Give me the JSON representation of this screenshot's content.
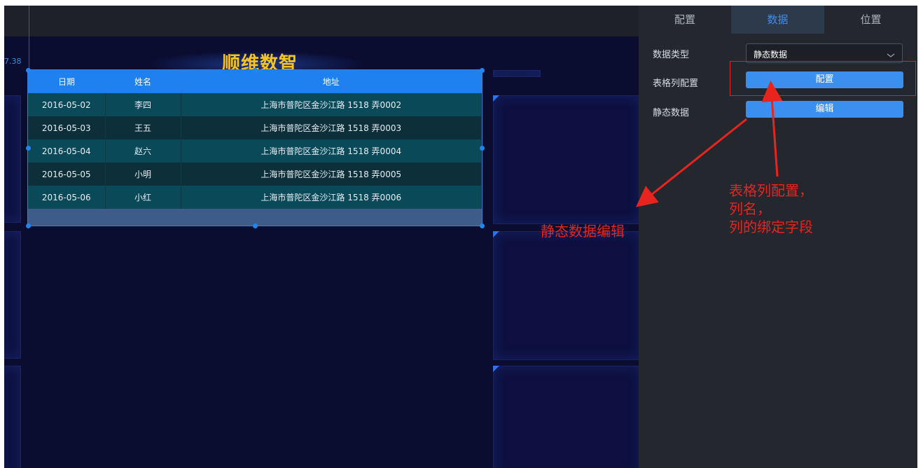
{
  "canvas": {
    "ruler_value": "7.38",
    "dashboard_title": "顺维数智"
  },
  "table": {
    "headers": [
      "日期",
      "姓名",
      "地址"
    ],
    "rows": [
      [
        "2016-05-02",
        "李四",
        "上海市普陀区金沙江路 1518 弄0002"
      ],
      [
        "2016-05-03",
        "王五",
        "上海市普陀区金沙江路 1518 弄0003"
      ],
      [
        "2016-05-04",
        "赵六",
        "上海市普陀区金沙江路 1518 弄0004"
      ],
      [
        "2016-05-05",
        "小明",
        "上海市普陀区金沙江路 1518 弄0005"
      ],
      [
        "2016-05-06",
        "小红",
        "上海市普陀区金沙江路 1518 弄0006"
      ]
    ]
  },
  "panel": {
    "tabs": [
      "配置",
      "数据",
      "位置"
    ],
    "active_tab": "数据",
    "data_type_label": "数据类型",
    "data_type_value": "静态数据",
    "column_config_label": "表格列配置",
    "column_config_button": "配置",
    "static_data_label": "静态数据",
    "static_data_button": "编辑"
  },
  "annotations": {
    "static_edit": "静态数据编辑",
    "column_config_lines": [
      "表格列配置，",
      "列名，",
      "列的绑定字段"
    ]
  },
  "colors": {
    "accent": "#3b90ef",
    "annotation_red": "#e8241f",
    "title_gold": "#f5c326",
    "table_header": "#1f80f0",
    "canvas_bg": "#0a0c30",
    "panel_bg": "#24272e"
  }
}
